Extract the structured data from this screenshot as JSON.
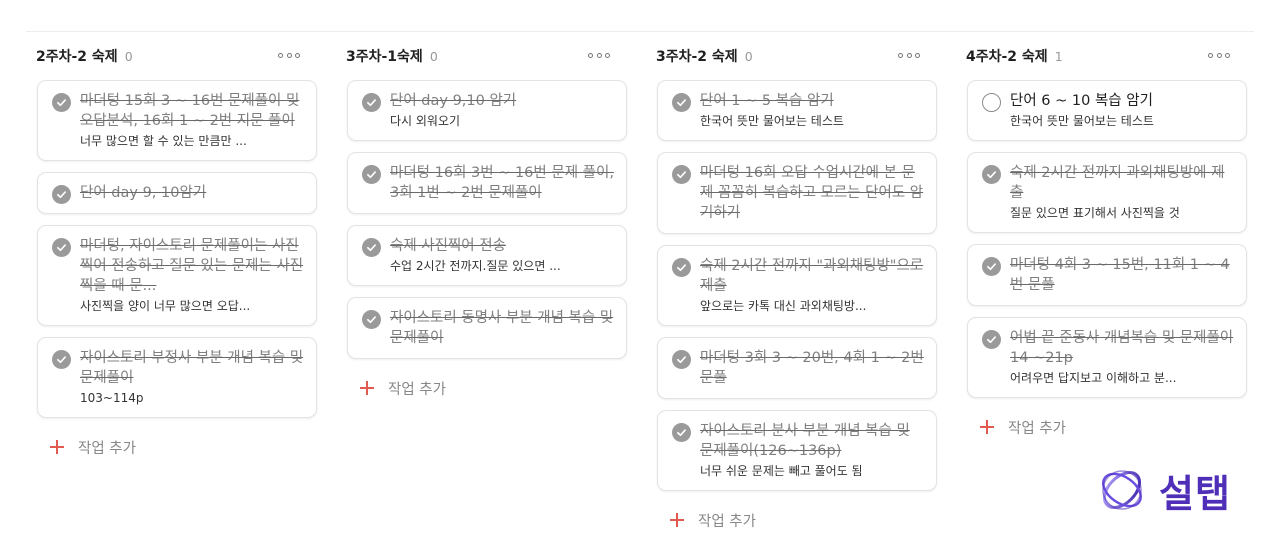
{
  "columns": [
    {
      "title": "2주차-2 숙제",
      "count": "0",
      "add_label": "작업 추가",
      "cards": [
        {
          "title": "마더텅 15회 3 ~ 16번 문제풀이 및 오답분석, 16회 1 ~ 2번 지문 풀이",
          "desc": "너무 많으면 할 수 있는 만큼만 ...",
          "done": true
        },
        {
          "title": "단어 day 9, 10암기",
          "desc": "",
          "done": true
        },
        {
          "title": "마더텅, 자이스토리 문제풀이는 사진 찍어 전송하고 질문 있는 문제는 사진찍을 때 문...",
          "desc": "사진찍을 양이 너무 많으면 오답...",
          "done": true
        },
        {
          "title": "자이스토리 부정사 부분 개념 복습 및 문제풀이",
          "desc": "103~114p",
          "done": true
        }
      ]
    },
    {
      "title": "3주차-1숙제",
      "count": "0",
      "add_label": "작업 추가",
      "cards": [
        {
          "title": "단어 day 9,10 암기",
          "desc": "다시 외워오기",
          "done": true
        },
        {
          "title": "마더텅 16회 3번 ~ 16번 문제 풀이, 3회 1번 ~ 2번 문제풀이",
          "desc": "",
          "done": true
        },
        {
          "title": "숙제 사진찍어 전송",
          "desc": "수업 2시간 전까지.질문 있으면 ...",
          "done": true
        },
        {
          "title": "자이스토리 동명사 부분 개념 복습 및 문제풀이",
          "desc": "",
          "done": true
        }
      ]
    },
    {
      "title": "3주차-2 숙제",
      "count": "0",
      "add_label": "작업 추가",
      "cards": [
        {
          "title": "단어 1 ~ 5 복습 암기",
          "desc": "한국어 뜻만 물어보는 테스트",
          "done": true
        },
        {
          "title": "마더텅 16회 오답 수업시간에 본 문제 꼼꼼히 복습하고 모르는 단어도 암기하기",
          "desc": "",
          "done": true
        },
        {
          "title": "숙제 2시간 전까지 \"과외채팅방\"으로 제출",
          "desc": "앞으로는 카톡 대신 과외채팅방...",
          "done": true
        },
        {
          "title": "마더텅 3회 3 ~ 20번, 4회 1 ~ 2번 문풀",
          "desc": "",
          "done": true
        },
        {
          "title": "자이스토리 분사 부분 개념 복습 및 문제풀이(126~136p)",
          "desc": "너무 쉬운 문제는 빼고 풀어도 됨",
          "done": true
        }
      ]
    },
    {
      "title": "4주차-2 숙제",
      "count": "1",
      "add_label": "작업 추가",
      "cards": [
        {
          "title": "단어 6 ~ 10 복습 암기",
          "desc": "한국어 뜻만 물어보는 테스트",
          "done": false
        },
        {
          "title": "숙제 2시간 전까지 과외채팅방에 제출",
          "desc": "질문 있으면 표기해서 사진찍을 것",
          "done": true
        },
        {
          "title": "마더텅 4회 3 ~ 15번, 11회 1 ~ 4번 문풀",
          "desc": "",
          "done": true
        },
        {
          "title": "어법 끝 준동사 개념복습 및 문제풀이 14 ~21p",
          "desc": "어려우면 답지보고 이해하고 분...",
          "done": true
        }
      ]
    }
  ],
  "logo": {
    "text": "설탭"
  },
  "colors": {
    "accent_plus": "#e05a4f",
    "check_done": "#9a9a9a",
    "logo": "#4f2fb8"
  },
  "icons": {
    "check": "check-icon",
    "more": "more-horizontal-icon",
    "add": "plus-icon"
  }
}
